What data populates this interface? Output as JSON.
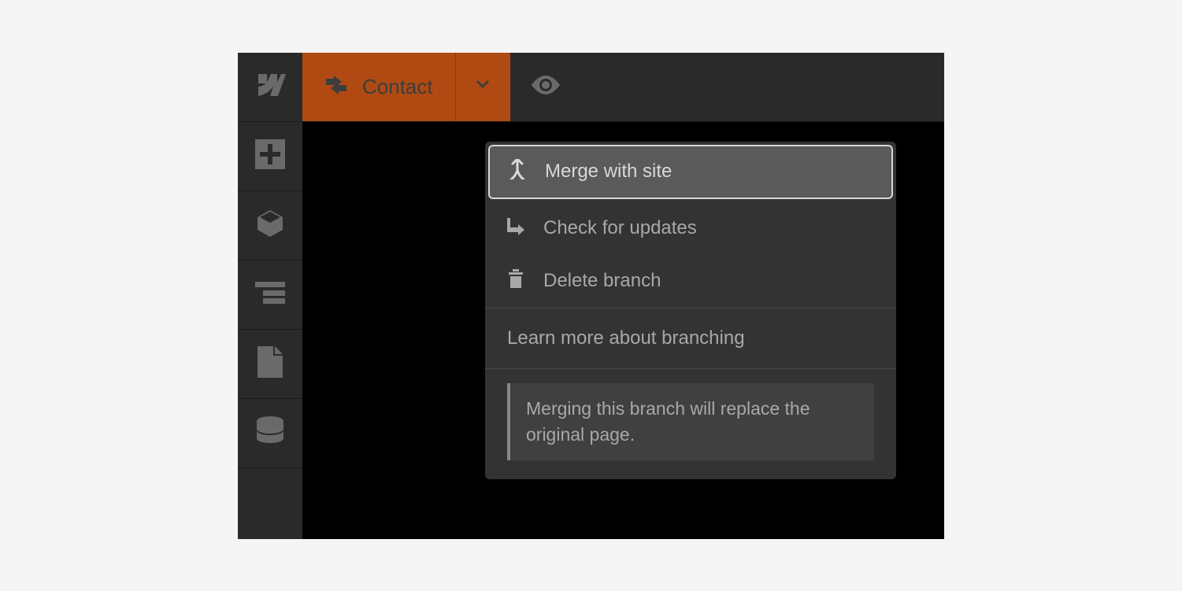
{
  "topbar": {
    "branch_label": "Contact"
  },
  "menu": {
    "merge": "Merge with site",
    "check_updates": "Check for updates",
    "delete_branch": "Delete branch",
    "learn_more": "Learn more about branching",
    "note": "Merging this branch will replace the original page."
  }
}
